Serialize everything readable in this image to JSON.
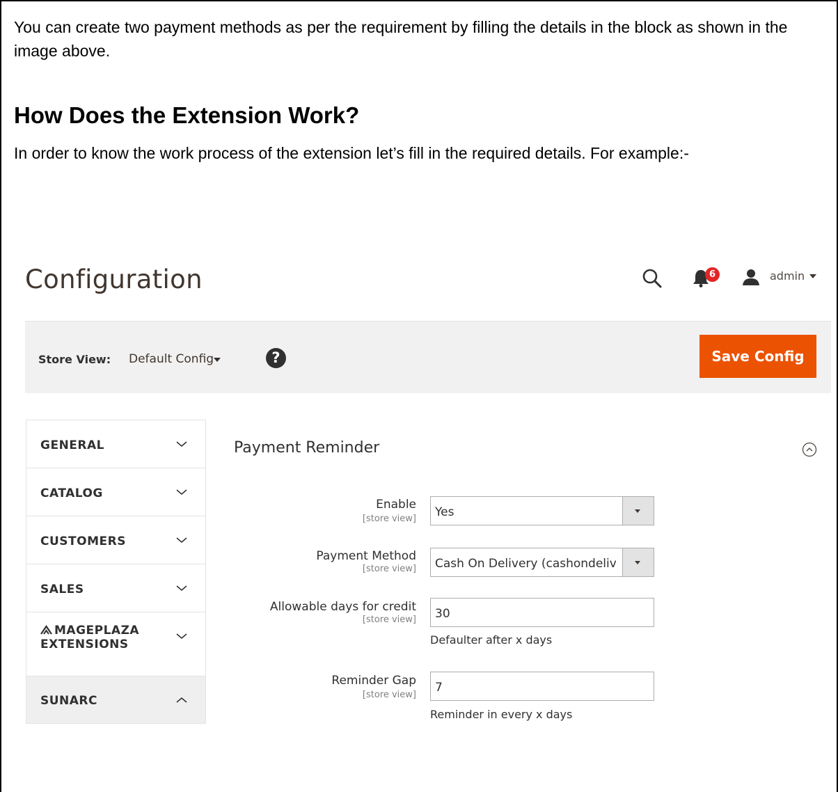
{
  "article": {
    "intro": "You can create two payment methods as per the requirement by filling the details in the block as shown in the image above.",
    "heading": "How Does the Extension Work?",
    "lead": "In order to know the work process of the extension let’s fill in the required details. For example:-"
  },
  "admin_header": {
    "title": "Configuration",
    "notification_count": "6",
    "user": "admin"
  },
  "store_bar": {
    "label": "Store View:",
    "selected": "Default Config",
    "save_label": "Save Config"
  },
  "sidebar": {
    "items": [
      {
        "label": "GENERAL"
      },
      {
        "label": "CATALOG"
      },
      {
        "label": "CUSTOMERS"
      },
      {
        "label": "SALES"
      },
      {
        "label": "MAGEPLAZA EXTENSIONS"
      },
      {
        "label": "SUNARC"
      }
    ]
  },
  "section": {
    "title": "Payment Reminder",
    "fields": [
      {
        "label": "Enable",
        "scope": "[store view]",
        "value": "Yes"
      },
      {
        "label": "Payment Method",
        "scope": "[store view]",
        "value": "Cash On Delivery (cashondeliv"
      },
      {
        "label": "Allowable days for credit",
        "scope": "[store view]",
        "value": "30",
        "note": "Defaulter after x days"
      },
      {
        "label": "Reminder Gap",
        "scope": "[store view]",
        "value": "7",
        "note": "Reminder in every x days"
      }
    ]
  },
  "colors": {
    "accent": "#eb5202",
    "badge": "#e22626",
    "store_bar_bg": "#f1f1f1"
  }
}
